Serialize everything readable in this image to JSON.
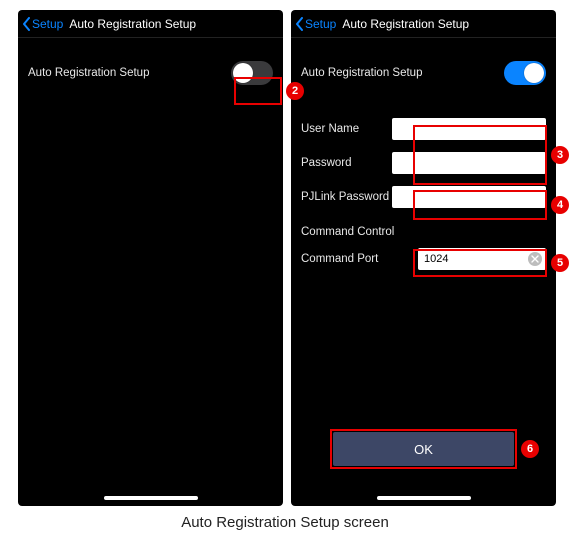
{
  "nav": {
    "back_label": "Setup",
    "title": "Auto Registration Setup"
  },
  "left_screen": {
    "toggle_label": "Auto Registration Setup",
    "toggle_on": false
  },
  "right_screen": {
    "toggle_label": "Auto Registration Setup",
    "toggle_on": true,
    "fields": {
      "user_name": {
        "label": "User Name",
        "value": ""
      },
      "password": {
        "label": "Password",
        "value": ""
      },
      "pjlink_password": {
        "label": "PJLink Password",
        "value": ""
      }
    },
    "command_section": "Command Control",
    "command_port": {
      "label": "Command Port",
      "value": "1024"
    },
    "ok_label": "OK"
  },
  "callouts": {
    "n2": "2",
    "n3": "3",
    "n4": "4",
    "n5": "5",
    "n6": "6"
  },
  "caption": "Auto Registration Setup screen"
}
